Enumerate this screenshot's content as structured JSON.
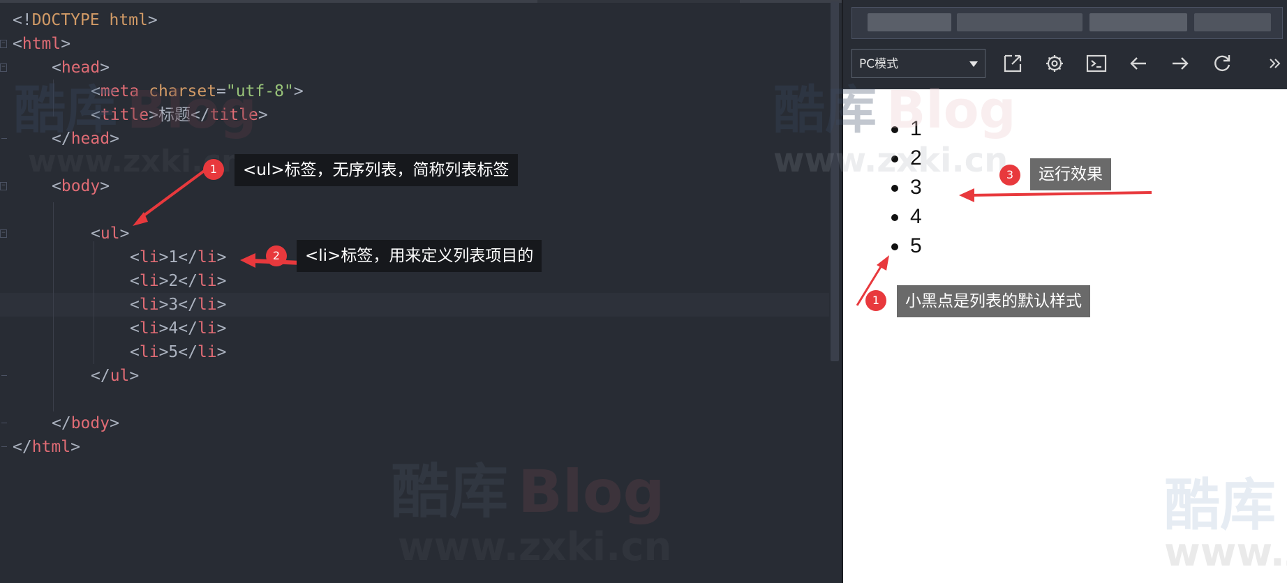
{
  "editor": {
    "lines": [
      {
        "parts": [
          {
            "c": "p",
            "t": "<!"
          },
          {
            "c": "a",
            "t": "DOCTYPE html"
          },
          {
            "c": "p",
            "t": ">"
          }
        ]
      },
      {
        "parts": [
          {
            "c": "p",
            "t": "<"
          },
          {
            "c": "t",
            "t": "html"
          },
          {
            "c": "p",
            "t": ">"
          }
        ]
      },
      {
        "parts": [
          {
            "c": "p",
            "t": "<"
          },
          {
            "c": "t",
            "t": "head"
          },
          {
            "c": "p",
            "t": ">"
          }
        ]
      },
      {
        "parts": [
          {
            "c": "p",
            "t": "<"
          },
          {
            "c": "t",
            "t": "meta"
          },
          {
            "c": "p",
            "t": " "
          },
          {
            "c": "a",
            "t": "charset"
          },
          {
            "c": "p",
            "t": "="
          },
          {
            "c": "s",
            "t": "\"utf-8\""
          },
          {
            "c": "p",
            "t": ">"
          }
        ]
      },
      {
        "parts": [
          {
            "c": "p",
            "t": "<"
          },
          {
            "c": "t",
            "t": "title"
          },
          {
            "c": "p",
            "t": ">标题</"
          },
          {
            "c": "t",
            "t": "title"
          },
          {
            "c": "p",
            "t": ">"
          }
        ]
      },
      {
        "parts": [
          {
            "c": "p",
            "t": "</"
          },
          {
            "c": "t",
            "t": "head"
          },
          {
            "c": "p",
            "t": ">"
          }
        ]
      },
      {
        "parts": []
      },
      {
        "parts": [
          {
            "c": "p",
            "t": "<"
          },
          {
            "c": "t",
            "t": "body"
          },
          {
            "c": "p",
            "t": ">"
          }
        ]
      },
      {
        "parts": []
      },
      {
        "parts": [
          {
            "c": "p",
            "t": "<"
          },
          {
            "c": "t",
            "t": "ul"
          },
          {
            "c": "p",
            "t": ">"
          }
        ]
      },
      {
        "parts": [
          {
            "c": "p",
            "t": "<"
          },
          {
            "c": "t",
            "t": "li"
          },
          {
            "c": "p",
            "t": ">1</"
          },
          {
            "c": "t",
            "t": "li"
          },
          {
            "c": "p",
            "t": ">"
          }
        ]
      },
      {
        "parts": [
          {
            "c": "p",
            "t": "<"
          },
          {
            "c": "t",
            "t": "li"
          },
          {
            "c": "p",
            "t": ">2</"
          },
          {
            "c": "t",
            "t": "li"
          },
          {
            "c": "p",
            "t": ">"
          }
        ]
      },
      {
        "parts": [
          {
            "c": "p",
            "t": "<"
          },
          {
            "c": "t",
            "t": "li"
          },
          {
            "c": "p",
            "t": ">3</"
          },
          {
            "c": "t",
            "t": "li"
          },
          {
            "c": "p",
            "t": ">"
          }
        ]
      },
      {
        "parts": [
          {
            "c": "p",
            "t": "<"
          },
          {
            "c": "t",
            "t": "li"
          },
          {
            "c": "p",
            "t": ">4</"
          },
          {
            "c": "t",
            "t": "li"
          },
          {
            "c": "p",
            "t": ">"
          }
        ]
      },
      {
        "parts": [
          {
            "c": "p",
            "t": "<"
          },
          {
            "c": "t",
            "t": "li"
          },
          {
            "c": "p",
            "t": ">5</"
          },
          {
            "c": "t",
            "t": "li"
          },
          {
            "c": "p",
            "t": ">"
          }
        ]
      },
      {
        "parts": [
          {
            "c": "p",
            "t": "</"
          },
          {
            "c": "t",
            "t": "ul"
          },
          {
            "c": "p",
            "t": ">"
          }
        ]
      },
      {
        "parts": []
      },
      {
        "parts": [
          {
            "c": "p",
            "t": "</"
          },
          {
            "c": "t",
            "t": "body"
          },
          {
            "c": "p",
            "t": ">"
          }
        ]
      },
      {
        "parts": [
          {
            "c": "p",
            "t": "</"
          },
          {
            "c": "t",
            "t": "html"
          },
          {
            "c": "p",
            "t": ">"
          }
        ]
      }
    ],
    "current_line": 13,
    "colors": {
      "tag": "#e06c75",
      "attr": "#d19a66",
      "string": "#98c379",
      "punct": "#abb2bf",
      "background": "#282c34"
    }
  },
  "preview": {
    "mode_select": "PC模式",
    "toolbar_icons": [
      "expand-icon",
      "settings-icon",
      "console-icon",
      "back-arrow-icon",
      "forward-arrow-icon",
      "refresh-icon",
      "more-chevron-icon"
    ],
    "list_items": [
      "1",
      "2",
      "3",
      "4",
      "5"
    ]
  },
  "annotations": [
    {
      "badge": "1",
      "text": "<ul>标签，无序列表，简称列表标签"
    },
    {
      "badge": "2",
      "text": "<li>标签，用来定义列表项目的"
    },
    {
      "badge": "3",
      "text": "运行效果"
    },
    {
      "badge": "1",
      "text": "小黑点是列表的默认样式"
    }
  ],
  "watermarks": {
    "brand_cn": "酷库",
    "brand_en": "Blog",
    "url_1": "www.zxki.cn",
    "url_2": "www.zxki.cn"
  },
  "accent_colors": {
    "badge": "#e8393d",
    "arrow": "#e8393d"
  }
}
